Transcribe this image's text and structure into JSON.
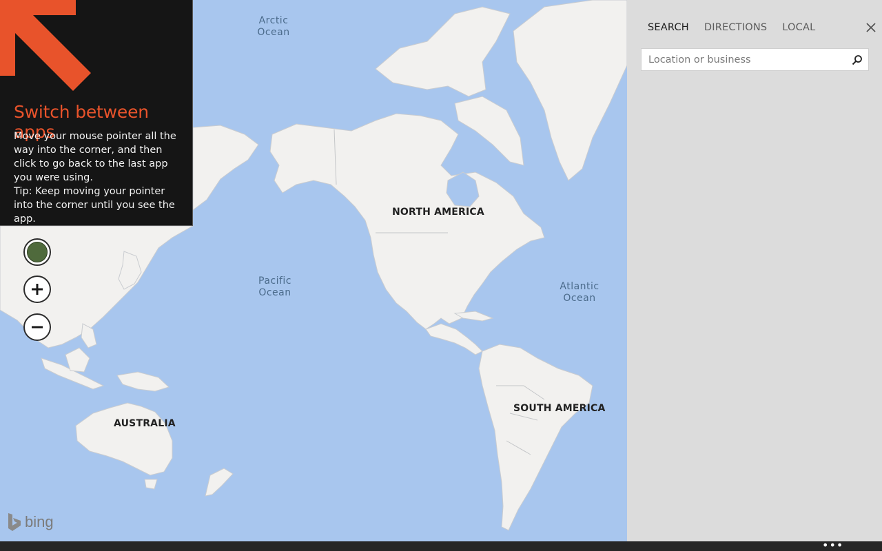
{
  "map": {
    "continent_labels": {
      "north_america": "NORTH AMERICA",
      "south_america": "SOUTH AMERICA",
      "australia": "AUSTRALIA"
    },
    "ocean_labels": {
      "arctic_line1": "Arctic",
      "arctic_line2": "Ocean",
      "pacific_line1": "Pacific",
      "pacific_line2": "Ocean",
      "atlantic_line1": "Atlantic",
      "atlantic_line2": "Ocean"
    },
    "controls": {
      "style_icon": "map-style-icon",
      "zoom_in_icon": "plus-icon",
      "zoom_out_icon": "minus-icon"
    },
    "logo_text": "bing",
    "colors": {
      "water": "#a8c6ee",
      "land": "#f2f1ef"
    }
  },
  "tip": {
    "title": "Switch between apps",
    "line1": "Move your mouse pointer all the way into the corner, and then click to go back to the last app you were using.",
    "line2": "Tip: Keep moving your pointer into the corner until you see the app.",
    "accent_color": "#e8532b"
  },
  "search_pane": {
    "tabs": [
      {
        "label": "SEARCH",
        "active": true
      },
      {
        "label": "DIRECTIONS",
        "active": false
      },
      {
        "label": "LOCAL",
        "active": false
      }
    ],
    "close_icon": "close-icon",
    "search": {
      "placeholder": "Location or business",
      "value": "",
      "icon": "search-icon"
    }
  },
  "app_bar": {
    "more_label": "•••"
  }
}
